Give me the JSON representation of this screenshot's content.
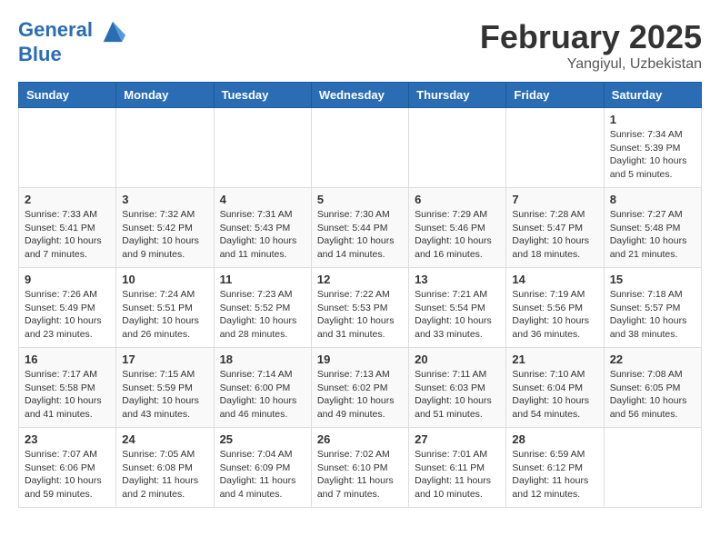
{
  "header": {
    "logo_line1": "General",
    "logo_line2": "Blue",
    "month_title": "February 2025",
    "location": "Yangiyul, Uzbekistan"
  },
  "weekdays": [
    "Sunday",
    "Monday",
    "Tuesday",
    "Wednesday",
    "Thursday",
    "Friday",
    "Saturday"
  ],
  "weeks": [
    [
      {
        "day": "",
        "info": ""
      },
      {
        "day": "",
        "info": ""
      },
      {
        "day": "",
        "info": ""
      },
      {
        "day": "",
        "info": ""
      },
      {
        "day": "",
        "info": ""
      },
      {
        "day": "",
        "info": ""
      },
      {
        "day": "1",
        "info": "Sunrise: 7:34 AM\nSunset: 5:39 PM\nDaylight: 10 hours and 5 minutes."
      }
    ],
    [
      {
        "day": "2",
        "info": "Sunrise: 7:33 AM\nSunset: 5:41 PM\nDaylight: 10 hours and 7 minutes."
      },
      {
        "day": "3",
        "info": "Sunrise: 7:32 AM\nSunset: 5:42 PM\nDaylight: 10 hours and 9 minutes."
      },
      {
        "day": "4",
        "info": "Sunrise: 7:31 AM\nSunset: 5:43 PM\nDaylight: 10 hours and 11 minutes."
      },
      {
        "day": "5",
        "info": "Sunrise: 7:30 AM\nSunset: 5:44 PM\nDaylight: 10 hours and 14 minutes."
      },
      {
        "day": "6",
        "info": "Sunrise: 7:29 AM\nSunset: 5:46 PM\nDaylight: 10 hours and 16 minutes."
      },
      {
        "day": "7",
        "info": "Sunrise: 7:28 AM\nSunset: 5:47 PM\nDaylight: 10 hours and 18 minutes."
      },
      {
        "day": "8",
        "info": "Sunrise: 7:27 AM\nSunset: 5:48 PM\nDaylight: 10 hours and 21 minutes."
      }
    ],
    [
      {
        "day": "9",
        "info": "Sunrise: 7:26 AM\nSunset: 5:49 PM\nDaylight: 10 hours and 23 minutes."
      },
      {
        "day": "10",
        "info": "Sunrise: 7:24 AM\nSunset: 5:51 PM\nDaylight: 10 hours and 26 minutes."
      },
      {
        "day": "11",
        "info": "Sunrise: 7:23 AM\nSunset: 5:52 PM\nDaylight: 10 hours and 28 minutes."
      },
      {
        "day": "12",
        "info": "Sunrise: 7:22 AM\nSunset: 5:53 PM\nDaylight: 10 hours and 31 minutes."
      },
      {
        "day": "13",
        "info": "Sunrise: 7:21 AM\nSunset: 5:54 PM\nDaylight: 10 hours and 33 minutes."
      },
      {
        "day": "14",
        "info": "Sunrise: 7:19 AM\nSunset: 5:56 PM\nDaylight: 10 hours and 36 minutes."
      },
      {
        "day": "15",
        "info": "Sunrise: 7:18 AM\nSunset: 5:57 PM\nDaylight: 10 hours and 38 minutes."
      }
    ],
    [
      {
        "day": "16",
        "info": "Sunrise: 7:17 AM\nSunset: 5:58 PM\nDaylight: 10 hours and 41 minutes."
      },
      {
        "day": "17",
        "info": "Sunrise: 7:15 AM\nSunset: 5:59 PM\nDaylight: 10 hours and 43 minutes."
      },
      {
        "day": "18",
        "info": "Sunrise: 7:14 AM\nSunset: 6:00 PM\nDaylight: 10 hours and 46 minutes."
      },
      {
        "day": "19",
        "info": "Sunrise: 7:13 AM\nSunset: 6:02 PM\nDaylight: 10 hours and 49 minutes."
      },
      {
        "day": "20",
        "info": "Sunrise: 7:11 AM\nSunset: 6:03 PM\nDaylight: 10 hours and 51 minutes."
      },
      {
        "day": "21",
        "info": "Sunrise: 7:10 AM\nSunset: 6:04 PM\nDaylight: 10 hours and 54 minutes."
      },
      {
        "day": "22",
        "info": "Sunrise: 7:08 AM\nSunset: 6:05 PM\nDaylight: 10 hours and 56 minutes."
      }
    ],
    [
      {
        "day": "23",
        "info": "Sunrise: 7:07 AM\nSunset: 6:06 PM\nDaylight: 10 hours and 59 minutes."
      },
      {
        "day": "24",
        "info": "Sunrise: 7:05 AM\nSunset: 6:08 PM\nDaylight: 11 hours and 2 minutes."
      },
      {
        "day": "25",
        "info": "Sunrise: 7:04 AM\nSunset: 6:09 PM\nDaylight: 11 hours and 4 minutes."
      },
      {
        "day": "26",
        "info": "Sunrise: 7:02 AM\nSunset: 6:10 PM\nDaylight: 11 hours and 7 minutes."
      },
      {
        "day": "27",
        "info": "Sunrise: 7:01 AM\nSunset: 6:11 PM\nDaylight: 11 hours and 10 minutes."
      },
      {
        "day": "28",
        "info": "Sunrise: 6:59 AM\nSunset: 6:12 PM\nDaylight: 11 hours and 12 minutes."
      },
      {
        "day": "",
        "info": ""
      }
    ]
  ]
}
